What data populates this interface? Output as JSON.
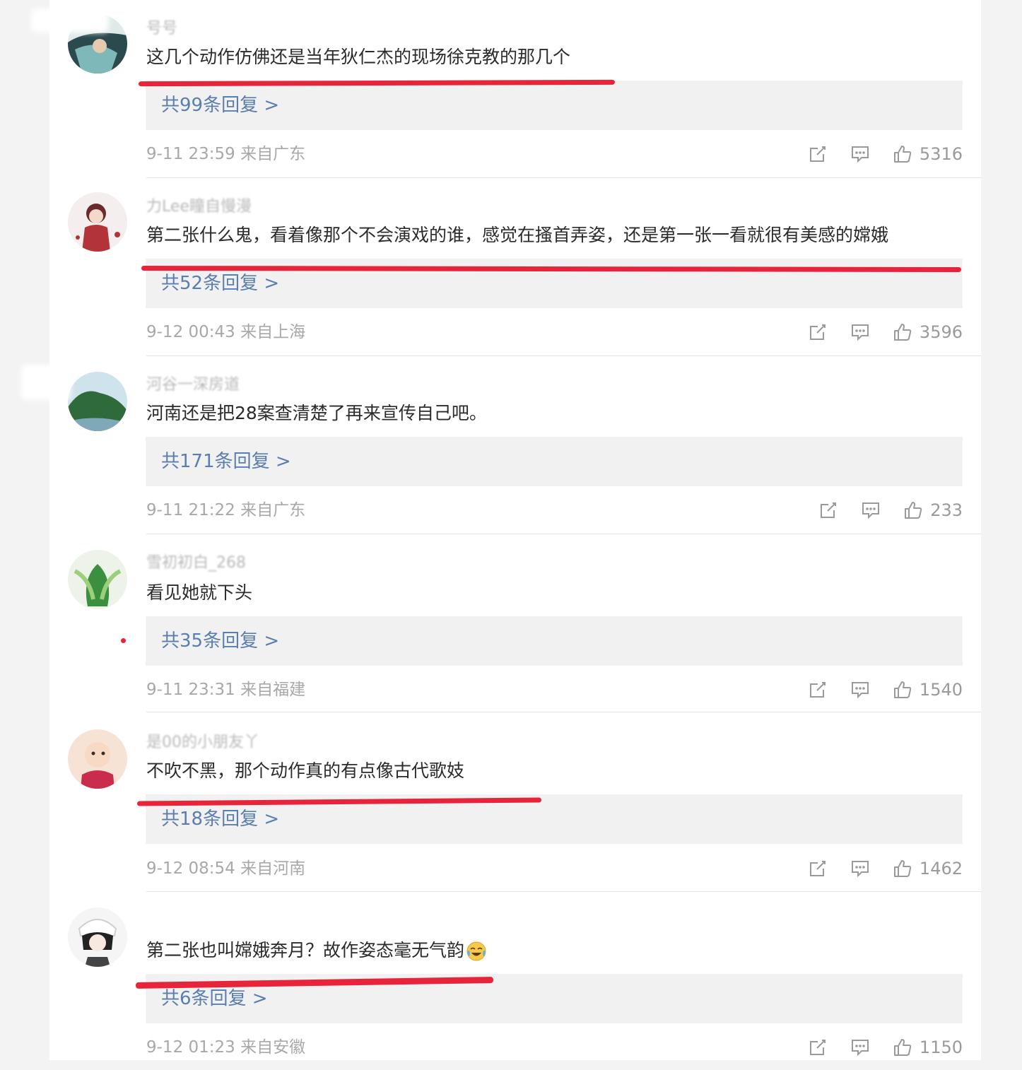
{
  "comments": [
    {
      "username": "号号",
      "text": "这几个动作仿佛还是当年狄仁杰的现场徐克教的那几个",
      "replies": "共99条回复 >",
      "time": "9-11 23:59",
      "location": "来自广东",
      "likes": "5316",
      "avatar_colors": [
        "#2b4a4e",
        "#7fb8b8"
      ],
      "highlighted": true
    },
    {
      "username": "力Lee瞳自慢漫",
      "text": "第二张什么鬼，看着像那个不会演戏的谁，感觉在搔首弄姿，还是第一张一看就很有美感的嫦娥",
      "replies": "共52条回复 >",
      "time": "9-12 00:43",
      "location": "来自上海",
      "likes": "3596",
      "avatar_colors": [
        "#f4eeee",
        "#b2343a"
      ],
      "highlighted": true
    },
    {
      "username": "河谷一深房道",
      "text": "河南还是把28案查清楚了再来宣传自己吧。",
      "replies": "共171条回复 >",
      "time": "9-11 21:22",
      "location": "来自广东",
      "likes": "233",
      "avatar_colors": [
        "#cfe3ec",
        "#2f6b3a"
      ],
      "highlighted": false
    },
    {
      "username": "雪初初白_268",
      "text": "看见她就下头",
      "replies": "共35条回复 >",
      "time": "9-11 23:31",
      "location": "来自福建",
      "likes": "1540",
      "avatar_colors": [
        "#eef3ea",
        "#3c8f3e"
      ],
      "highlighted": false
    },
    {
      "username": "是00的小朋友丫",
      "text": "不吹不黑，那个动作真的有点像古代歌妓",
      "replies": "共18条回复 >",
      "time": "9-12 08:54",
      "location": "来自河南",
      "likes": "1462",
      "avatar_colors": [
        "#f6e3d6",
        "#c92d4b"
      ],
      "highlighted": true
    },
    {
      "username": "",
      "text": "第二张也叫嫦娥奔月？故作姿态毫无气韵",
      "replies": "共6条回复 >",
      "time": "9-12 01:23",
      "location": "来自安徽",
      "likes": "1150",
      "avatar_colors": [
        "#f5f5f5",
        "#222222"
      ],
      "highlighted": true,
      "emoji": "laughing-crying-emoji"
    }
  ],
  "colors": {
    "underline": "#e8243a",
    "link": "#5b7eb1",
    "meta": "#a8a8a8",
    "text": "#2b2b2b"
  }
}
